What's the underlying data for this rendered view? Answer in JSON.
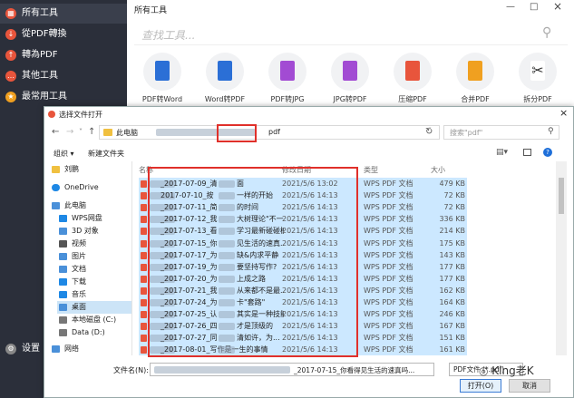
{
  "sidebar": {
    "items": [
      {
        "label": "所有工具",
        "icon": "grid-icon"
      },
      {
        "label": "從PDF轉換",
        "icon": "download-icon"
      },
      {
        "label": "轉為PDF",
        "icon": "upload-icon"
      },
      {
        "label": "其他工具",
        "icon": "more-icon"
      },
      {
        "label": "最常用工具",
        "icon": "star-icon"
      }
    ],
    "settings_label": "设置"
  },
  "app": {
    "title": "所有工具",
    "search_placeholder": "查找工具...",
    "minimize": "—",
    "maximize": "□",
    "close": "×",
    "tools": [
      {
        "label": "PDF转Word",
        "color": "#2b6fd6"
      },
      {
        "label": "Word转PDF",
        "color": "#2b6fd6"
      },
      {
        "label": "PDF转JPG",
        "color": "#a24bd3"
      },
      {
        "label": "JPG转PDF",
        "color": "#a24bd3"
      },
      {
        "label": "压缩PDF",
        "color": "#e8553c"
      },
      {
        "label": "合并PDF",
        "color": "#f0a020"
      },
      {
        "label": "拆分PDF",
        "color": "#555555"
      }
    ]
  },
  "dialog": {
    "title": "选择文件打开",
    "close": "×",
    "breadcrumb": {
      "root": "此电脑",
      "current": "pdf"
    },
    "search_placeholder": "搜索\"pdf\"",
    "toolbar": {
      "organize": "组织 ▾",
      "new_folder": "新建文件夹"
    },
    "nav": [
      {
        "label": "刘鹏",
        "color": "#f0c040"
      },
      {
        "label": "OneDrive",
        "color": "#1e88e5"
      },
      {
        "label": "此电脑",
        "color": "#4a90d9"
      },
      {
        "label": "WPS网盘",
        "color": "#1e88e5"
      },
      {
        "label": "3D 对象",
        "color": "#4a90d9"
      },
      {
        "label": "视频",
        "color": "#555555"
      },
      {
        "label": "图片",
        "color": "#4a90d9"
      },
      {
        "label": "文档",
        "color": "#4a90d9"
      },
      {
        "label": "下载",
        "color": "#1e88e5"
      },
      {
        "label": "音乐",
        "color": "#1e88e5"
      },
      {
        "label": "桌面",
        "color": "#4a90d9"
      },
      {
        "label": "本地磁盘 (C:)",
        "color": "#777777"
      },
      {
        "label": "Data (D:)",
        "color": "#777777"
      },
      {
        "label": "网络",
        "color": "#4a90d9"
      }
    ],
    "headers": {
      "name": "名称",
      "date": "修改日期",
      "type": "类型",
      "size": "大小"
    },
    "files": [
      {
        "name": "_2017-07-09_清",
        "suffix": "面",
        "date": "2021/5/6 13:02",
        "type": "WPS PDF 文档",
        "size": "479 KB"
      },
      {
        "name": "2017-07-10_按",
        "suffix": "一样的开始",
        "date": "2021/5/6 14:13",
        "type": "WPS PDF 文档",
        "size": "72 KB"
      },
      {
        "name": "_2017-07-11_简",
        "suffix": "的时间",
        "date": "2021/5/6 14:13",
        "type": "WPS PDF 文档",
        "size": "72 KB"
      },
      {
        "name": "_2017-07-12_我",
        "suffix": "大树理论\"不一样",
        "date": "2021/5/6 14:13",
        "type": "WPS PDF 文档",
        "size": "336 KB"
      },
      {
        "name": "_2017-07-13_看",
        "suffix": "学习最新碰碰模频",
        "date": "2021/5/6 14:13",
        "type": "WPS PDF 文档",
        "size": "214 KB"
      },
      {
        "name": "_2017-07-15_你",
        "suffix": "见生活的速真...",
        "date": "2021/5/6 14:13",
        "type": "WPS PDF 文档",
        "size": "175 KB"
      },
      {
        "name": "_2017-07-17_为",
        "suffix": "缺&内求平静",
        "date": "2021/5/6 14:13",
        "type": "WPS PDF 文档",
        "size": "143 KB"
      },
      {
        "name": "_2017-07-19_为",
        "suffix": "要坚持写作?",
        "date": "2021/5/6 14:13",
        "type": "WPS PDF 文档",
        "size": "177 KB"
      },
      {
        "name": "_2017-07-20_为",
        "suffix": "上成之路",
        "date": "2021/5/6 14:13",
        "type": "WPS PDF 文档",
        "size": "177 KB"
      },
      {
        "name": "_2017-07-21_我",
        "suffix": "从来都不是最...",
        "date": "2021/5/6 14:13",
        "type": "WPS PDF 文档",
        "size": "162 KB"
      },
      {
        "name": "_2017-07-24_为",
        "suffix": "卡\"套路\"",
        "date": "2021/5/6 14:13",
        "type": "WPS PDF 文档",
        "size": "164 KB"
      },
      {
        "name": "_2017-07-25_认",
        "suffix": "其实是一种技能",
        "date": "2021/5/6 14:13",
        "type": "WPS PDF 文档",
        "size": "246 KB"
      },
      {
        "name": "_2017-07-26_四",
        "suffix": "才是顶级的",
        "date": "2021/5/6 14:13",
        "type": "WPS PDF 文档",
        "size": "167 KB"
      },
      {
        "name": "_2017-07-27_同",
        "suffix": "清如许，为...",
        "date": "2021/5/6 14:13",
        "type": "WPS PDF 文档",
        "size": "151 KB"
      },
      {
        "name": "_2017-08-01_写作是一生的事情",
        "suffix": "",
        "date": "2021/5/6 14:13",
        "type": "WPS PDF 文档",
        "size": "161 KB"
      }
    ],
    "filename_label": "文件名(N):",
    "filename_value": "_2017-07-15_你看得见生活的速真吗...",
    "filter": "PDF文件 (*.pdf)",
    "open_label": "打开(O)",
    "cancel_label": "取消"
  },
  "watermark": "King老K"
}
